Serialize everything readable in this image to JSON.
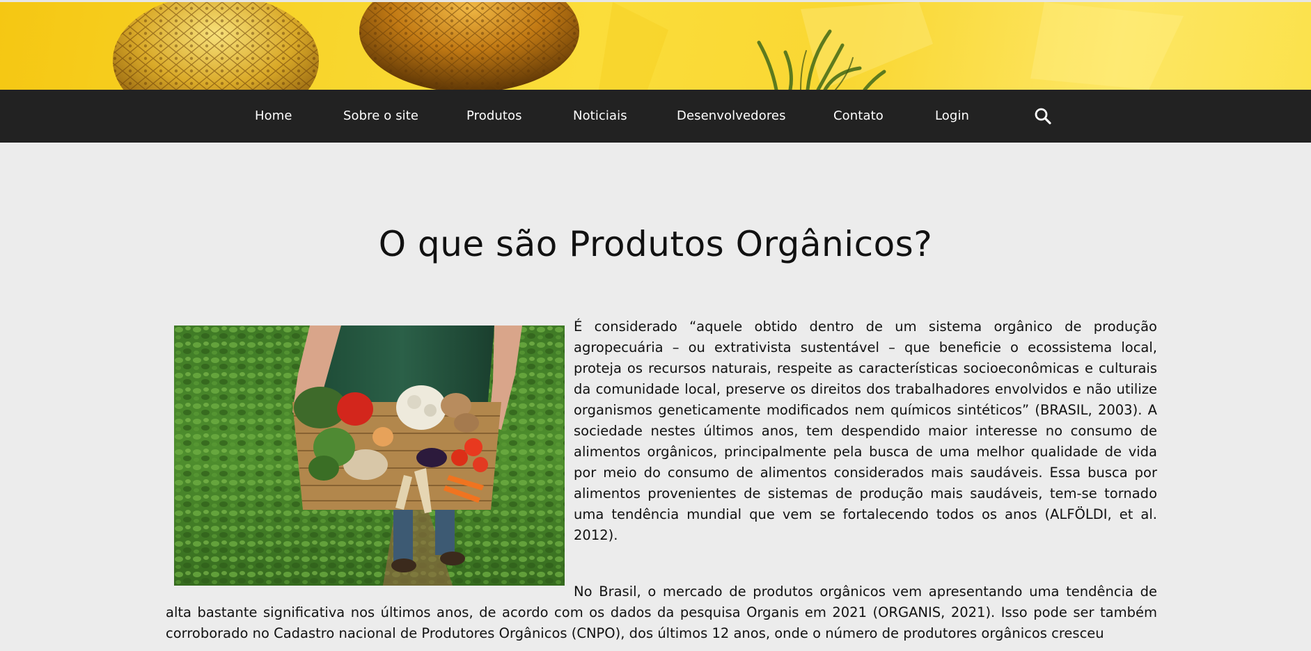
{
  "nav": {
    "items": [
      {
        "key": "home",
        "label": "Home"
      },
      {
        "key": "sobre",
        "label": "Sobre o site"
      },
      {
        "key": "produtos",
        "label": "Produtos"
      },
      {
        "key": "noticias",
        "label": "Noticiais"
      },
      {
        "key": "desenvolvedores",
        "label": "Desenvolvedores"
      },
      {
        "key": "contato",
        "label": "Contato"
      },
      {
        "key": "login",
        "label": "Login"
      }
    ],
    "search_icon": "search-icon"
  },
  "hero": {
    "image": "pineapples-banner",
    "accent": "#f8d52c"
  },
  "main": {
    "title": "O que são Produtos Orgânicos?",
    "image": "basket-of-organic-vegetables",
    "paragraph1": "É considerado “aquele obtido dentro de um sistema orgânico de produção agropecuária – ou extrativista sustentável – que beneficie o ecossistema local, proteja os recursos naturais, respeite as características socioeconômicas e culturais da comunidade local, preserve os direitos dos trabalhadores envolvidos e não utilize organismos geneticamente modificados nem químicos sintéticos” (BRASIL, 2003). A sociedade nestes últimos anos, tem despendido maior interesse no consumo de alimentos orgânicos, principalmente pela busca de uma melhor qualidade de vida por meio do consumo de alimentos considerados mais saudáveis. Essa busca por alimentos provenientes de sistemas de produção mais saudáveis, tem-se tornado uma tendência mundial que vem se fortalecendo todos os anos (ALFÖLDI, et al. 2012).",
    "paragraph2": "No Brasil, o mercado de produtos orgânicos vem apresentando uma tendência de alta bastante significativa nos últimos anos, de acordo com os dados da pesquisa Organis em 2021 (ORGANIS, 2021). Isso pode ser também corroborado no Cadastro nacional de Produtores Orgânicos (CNPO), dos últimos 12 anos, onde o número de produtores orgânicos cresceu"
  },
  "colors": {
    "navbar": "#222222",
    "background": "#ececec",
    "text": "#111111"
  }
}
